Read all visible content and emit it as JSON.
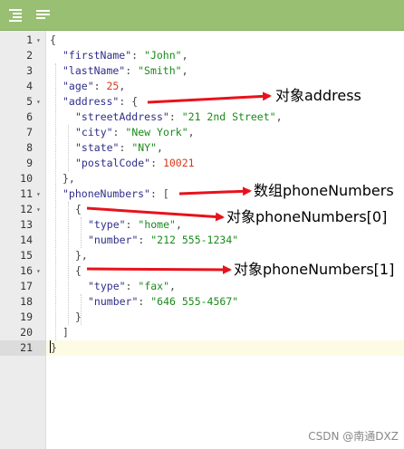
{
  "toolbar": {
    "format_icon": "format-lines-icon",
    "compact_icon": "compact-lines-icon",
    "color": "#98bf72"
  },
  "code_lines": [
    {
      "num": "1",
      "fold": true,
      "text": "{"
    },
    {
      "num": "2",
      "fold": false,
      "key": "\"firstName\"",
      "value": "\"John\"",
      "tail": ","
    },
    {
      "num": "3",
      "fold": false,
      "key": "\"lastName\"",
      "value": "\"Smith\"",
      "tail": ","
    },
    {
      "num": "4",
      "fold": false,
      "key": "\"age\"",
      "value": "25",
      "tail": ","
    },
    {
      "num": "5",
      "fold": true,
      "key": "\"address\"",
      "tail": ": {"
    },
    {
      "num": "6",
      "fold": false,
      "key": "\"streetAddress\"",
      "value": "\"21 2nd Street\"",
      "tail": ","
    },
    {
      "num": "7",
      "fold": false,
      "key": "\"city\"",
      "value": "\"New York\"",
      "tail": ","
    },
    {
      "num": "8",
      "fold": false,
      "key": "\"state\"",
      "value": "\"NY\"",
      "tail": ","
    },
    {
      "num": "9",
      "fold": false,
      "key": "\"postalCode\"",
      "value": "10021",
      "tail": ""
    },
    {
      "num": "10",
      "fold": false,
      "text": "},"
    },
    {
      "num": "11",
      "fold": true,
      "key": "\"phoneNumbers\"",
      "tail": ": ["
    },
    {
      "num": "12",
      "fold": true,
      "text": "{"
    },
    {
      "num": "13",
      "fold": false,
      "key": "\"type\"",
      "value": "\"home\"",
      "tail": ","
    },
    {
      "num": "14",
      "fold": false,
      "key": "\"number\"",
      "value": "\"212 555-1234\"",
      "tail": ""
    },
    {
      "num": "15",
      "fold": false,
      "text": "},"
    },
    {
      "num": "16",
      "fold": true,
      "text": "{"
    },
    {
      "num": "17",
      "fold": false,
      "key": "\"type\"",
      "value": "\"fax\"",
      "tail": ","
    },
    {
      "num": "18",
      "fold": false,
      "key": "\"number\"",
      "value": "\"646 555-4567\"",
      "tail": ""
    },
    {
      "num": "19",
      "fold": false,
      "text": "}"
    },
    {
      "num": "20",
      "fold": false,
      "text": "]"
    },
    {
      "num": "21",
      "fold": false,
      "text": "}"
    }
  ],
  "annotations": {
    "address": "对象address",
    "phone_array": "数组phoneNumbers",
    "phone_0": "对象phoneNumbers[0]",
    "phone_1": "对象phoneNumbers[1]"
  },
  "arrow_color": "#e8121c",
  "watermark": "CSDN @南通DXZ"
}
